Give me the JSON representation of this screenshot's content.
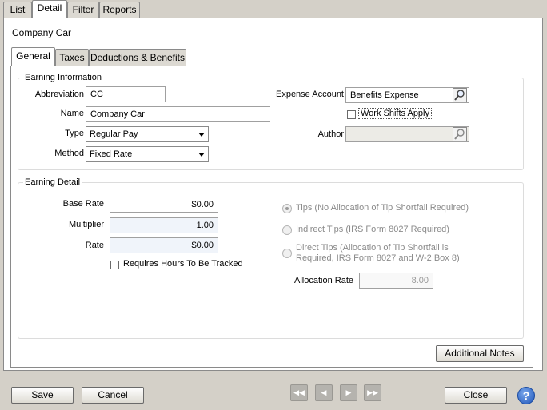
{
  "top_tabs": [
    {
      "label": "List",
      "active": false
    },
    {
      "label": "Detail",
      "active": true
    },
    {
      "label": "Filter",
      "active": false
    },
    {
      "label": "Reports",
      "active": false
    }
  ],
  "page_title": "Company Car",
  "inner_tabs": [
    {
      "label": "General",
      "active": true
    },
    {
      "label": "Taxes",
      "active": false
    },
    {
      "label": "Deductions & Benefits",
      "active": false
    }
  ],
  "earning_info": {
    "title": "Earning Information",
    "abbreviation": {
      "label": "Abbreviation",
      "value": "CC"
    },
    "name": {
      "label": "Name",
      "value": "Company Car"
    },
    "type": {
      "label": "Type",
      "value": "Regular Pay"
    },
    "method": {
      "label": "Method",
      "value": "Fixed Rate"
    },
    "expense_account": {
      "label": "Expense Account",
      "value": "Benefits Expense"
    },
    "work_shifts": {
      "label": "Work Shifts Apply",
      "checked": false
    },
    "author": {
      "label": "Author",
      "value": ""
    }
  },
  "earning_detail": {
    "title": "Earning Detail",
    "base_rate": {
      "label": "Base Rate",
      "value": "$0.00"
    },
    "multiplier": {
      "label": "Multiplier",
      "value": "1.00"
    },
    "rate": {
      "label": "Rate",
      "value": "$0.00"
    },
    "requires_hours": {
      "label": "Requires Hours To Be Tracked",
      "checked": false
    },
    "tips_options": [
      {
        "label": "Tips (No Allocation of Tip Shortfall Required)",
        "selected": true
      },
      {
        "label": "Indirect Tips (IRS Form 8027 Required)",
        "selected": false
      },
      {
        "label_line1": "Direct Tips (Allocation of Tip Shortfall is",
        "label_line2": "Required, IRS Form 8027 and W-2 Box 8)",
        "selected": false
      }
    ],
    "allocation_rate": {
      "label": "Allocation Rate",
      "value": "8.00"
    }
  },
  "buttons": {
    "additional_notes": "Additional Notes",
    "save": "Save",
    "cancel": "Cancel",
    "close": "Close",
    "help": "?"
  },
  "nav_icons": [
    "first-record-icon",
    "previous-record-icon",
    "next-record-icon",
    "last-record-icon"
  ],
  "colors": {
    "window_bg": "#d4d0c8",
    "panel_bg": "#ffffff",
    "help_blue": "#1f55b8"
  }
}
